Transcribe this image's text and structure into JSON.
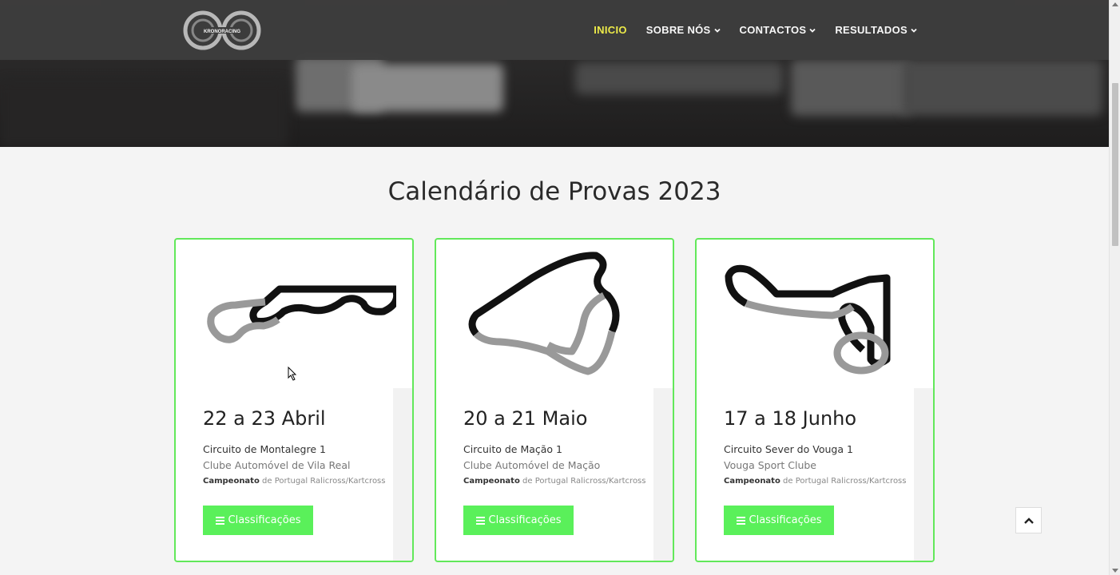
{
  "brand": {
    "logo_text": "KRONORACING"
  },
  "nav": {
    "items": [
      {
        "label": "INICIO",
        "active": true,
        "dropdown": false
      },
      {
        "label": "SOBRE NÓS",
        "active": false,
        "dropdown": true
      },
      {
        "label": "CONTACTOS",
        "active": false,
        "dropdown": true
      },
      {
        "label": "RESULTADOS",
        "active": false,
        "dropdown": true
      }
    ]
  },
  "section": {
    "title": "Calendário de Provas 2023"
  },
  "events": [
    {
      "date": "22 a 23 Abril",
      "circuit": "Circuito de Montalegre 1",
      "club": "Clube Automóvel de Vila Real",
      "champ_bold": "Campeonato",
      "champ_rest": " de Portugal Ralicross/Kartcross",
      "button": "Classificações"
    },
    {
      "date": "20 a 21 Maio",
      "circuit": "Circuito de Mação 1",
      "club": "Clube Automóvel de Mação",
      "champ_bold": "Campeonato",
      "champ_rest": " de Portugal Ralicross/Kartcross",
      "button": "Classificações"
    },
    {
      "date": "17 a 18 Junho",
      "circuit": "Circuito Sever do Vouga 1",
      "club": "Vouga Sport Clube",
      "champ_bold": "Campeonato",
      "champ_rest": " de Portugal Ralicross/Kartcross",
      "button": "Classificações"
    }
  ],
  "colors": {
    "accent_green": "#5af05a",
    "card_border": "#62e85a",
    "nav_active": "#f3f04a",
    "navbar_bg": "#3d3d3d"
  }
}
